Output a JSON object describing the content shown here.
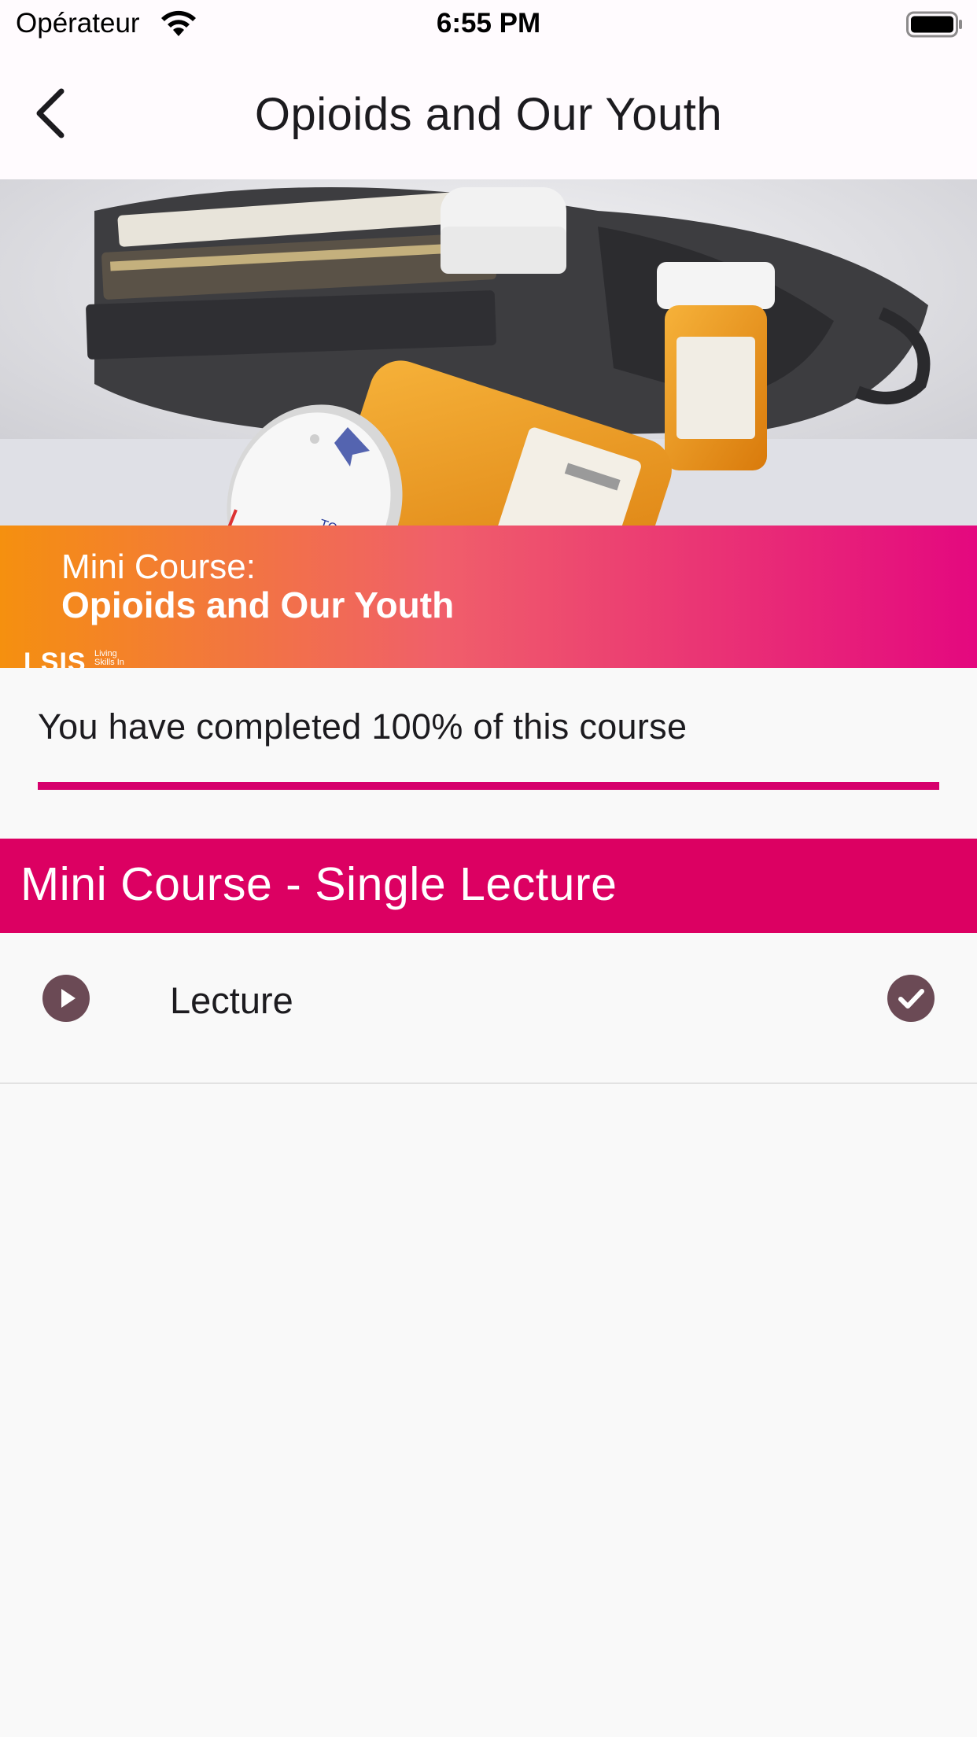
{
  "status_bar": {
    "carrier": "Opérateur",
    "time": "6:55 PM"
  },
  "app_bar": {
    "title": "Opioids and Our Youth",
    "back_icon": "chevron-left-icon"
  },
  "hero": {
    "banner_line1": "Mini Course:",
    "banner_line2": "Opioids and Our Youth",
    "logo_text": "LSIS",
    "logo_small_1": "Living",
    "logo_small_2": "Skills In"
  },
  "progress": {
    "text": "You have completed 100% of this course",
    "value": 1.0,
    "color": "#d6006c"
  },
  "section": {
    "title": "Mini Course - Single Lecture",
    "color": "#dc0062"
  },
  "lectures": [
    {
      "label": "Lecture",
      "icon": "play-circle-icon",
      "status_icon": "check-circle-icon",
      "completed": true
    }
  ]
}
